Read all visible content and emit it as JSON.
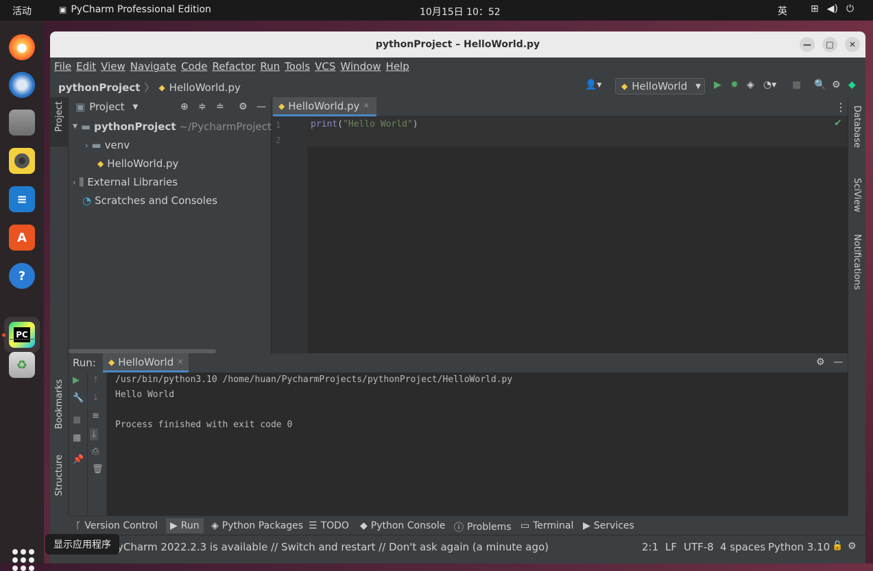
{
  "topbar": {
    "activities": "活动",
    "app_name": "PyCharm Professional Edition",
    "clock": "10月15日  10：52",
    "ime": "英"
  },
  "dock": {
    "tooltip": "显示应用程序"
  },
  "window": {
    "title": "pythonProject – HelloWorld.py"
  },
  "menu": [
    "File",
    "Edit",
    "View",
    "Navigate",
    "Code",
    "Refactor",
    "Run",
    "Tools",
    "VCS",
    "Window",
    "Help"
  ],
  "nav": {
    "project": "pythonProject",
    "file": "HelloWorld.py",
    "run_config": "HelloWorld"
  },
  "left_strip": {
    "project": "Project",
    "bookmarks": "Bookmarks",
    "structure": "Structure"
  },
  "right_strip": {
    "database": "Database",
    "sciview": "SciView",
    "notifications": "Notifications"
  },
  "project_panel": {
    "title": "Project",
    "tree": {
      "root": "pythonProject",
      "root_path": "~/PycharmProjects/",
      "venv": "venv",
      "file": "HelloWorld.py",
      "ext_libs": "External Libraries",
      "scratches": "Scratches and Consoles"
    }
  },
  "editor": {
    "tab": "HelloWorld.py",
    "lines": [
      {
        "no": "1",
        "fn": "print",
        "open": "(",
        "str": "\"Hello World\"",
        "close": ")"
      },
      {
        "no": "2"
      }
    ]
  },
  "run": {
    "label": "Run:",
    "tab": "HelloWorld",
    "console": [
      "/usr/bin/python3.10 /home/huan/PycharmProjects/pythonProject/HelloWorld.py",
      "Hello World",
      "",
      "Process finished with exit code 0"
    ]
  },
  "tool_windows": [
    "Version Control",
    "Run",
    "Python Packages",
    "TODO",
    "Python Console",
    "Problems",
    "Terminal",
    "Services"
  ],
  "status": {
    "message": "yCharm 2022.2.3 is available // Switch and restart // Don't ask again (a minute ago)",
    "position": "2:1",
    "line_sep": "LF",
    "encoding": "UTF-8",
    "indent": "4 spaces",
    "interpreter": "Python 3.10"
  },
  "colors": {
    "accent": "#4a88c7",
    "run_green": "#59a869",
    "ubuntu_orange": "#e95420"
  }
}
